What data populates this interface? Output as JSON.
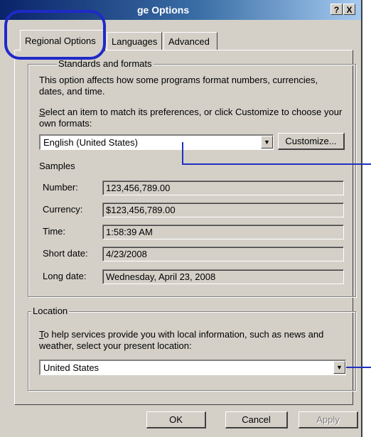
{
  "window": {
    "title": "ge Options",
    "help_glyph": "?",
    "close_glyph": "X"
  },
  "tabs": [
    {
      "label": "Regional Options"
    },
    {
      "label": "Languages"
    },
    {
      "label": "Advanced"
    }
  ],
  "standards": {
    "legend": "Standards and formats",
    "description": "This option affects how some programs format numbers, currencies, dates, and time.",
    "select_prompt_u": "S",
    "select_prompt": "elect an item to match its preferences, or click Customize to choose your own formats:",
    "format_value": "English (United States)",
    "customize_label": "Customize...",
    "samples_label": "Samples",
    "samples": [
      {
        "label": "Number:",
        "value": "123,456,789.00"
      },
      {
        "label": "Currency:",
        "value": "$123,456,789.00"
      },
      {
        "label": "Time:",
        "value": "1:58:39 AM"
      },
      {
        "label": "Short date:",
        "value": "4/23/2008"
      },
      {
        "label": "Long date:",
        "value": "Wednesday, April 23, 2008"
      }
    ]
  },
  "location": {
    "legend": "Location",
    "prompt_u": "T",
    "prompt": "o help services provide you with local information, such as news and weather, select your present location:",
    "value": "United States"
  },
  "buttons": {
    "ok": "OK",
    "cancel": "Cancel",
    "apply": "Apply"
  },
  "colors": {
    "highlight": "#1f2ac8",
    "titlebar": "#0a246a",
    "dialog_bg": "#d4d0c8"
  }
}
